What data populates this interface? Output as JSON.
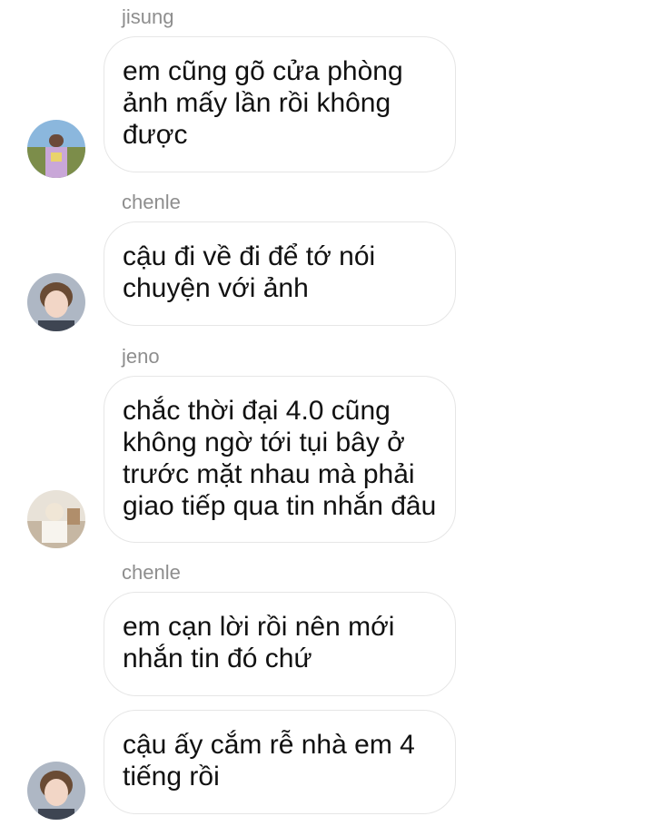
{
  "messages": [
    {
      "sender": "jisung",
      "text": "em cũng gõ cửa phòng ảnh mấy lần rồi không được",
      "avatar": "avatar-jisung"
    },
    {
      "sender": "chenle",
      "text": "cậu đi về đi để tớ nói chuyện với ảnh",
      "avatar": "avatar-chenle"
    },
    {
      "sender": "jeno",
      "text": "chắc thời đại 4.0 cũng không ngờ tới tụi bây ở trước mặt nhau mà phải giao tiếp qua tin nhắn đâu",
      "avatar": "avatar-jeno"
    },
    {
      "sender": "chenle",
      "text": "em cạn lời rồi nên mới nhắn tin đó chứ",
      "avatar": null
    },
    {
      "sender": null,
      "text": "cậu ấy cắm rễ nhà em 4 tiếng rồi",
      "avatar": "avatar-chenle"
    }
  ],
  "colors": {
    "bubble_border": "#e6e6e6",
    "sender_text": "#8e8e8e",
    "message_text": "#111111"
  }
}
